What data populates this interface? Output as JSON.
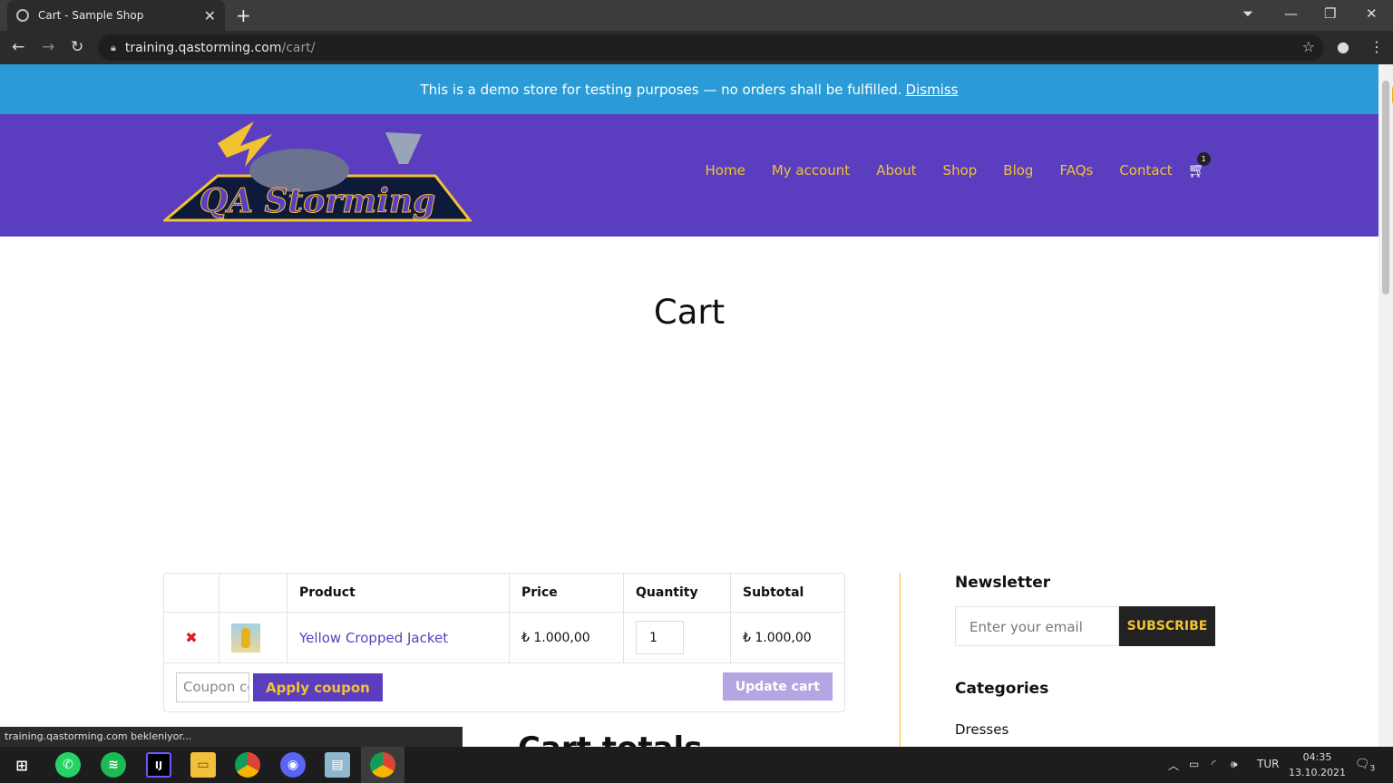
{
  "browser": {
    "tab_title": "Cart - Sample Shop",
    "url_host": "training.qastorming.com",
    "url_path": "/cart/"
  },
  "store": {
    "notice_text": "This is a demo store for testing purposes — no orders shall be fulfilled.",
    "notice_dismiss": "Dismiss",
    "logo_text": "QA Storming",
    "nav": [
      "Home",
      "My account",
      "About",
      "Shop",
      "Blog",
      "FAQs",
      "Contact"
    ],
    "cart_count": "1",
    "page_title": "Cart"
  },
  "cart": {
    "headers": [
      "Product",
      "Price",
      "Quantity",
      "Subtotal"
    ],
    "item": {
      "name": "Yellow Cropped Jacket",
      "price": "₺ 1.000,00",
      "quantity": "1",
      "subtotal": "₺ 1.000,00"
    },
    "coupon_placeholder": "Coupon code",
    "apply_label": "Apply coupon",
    "update_label": "Update cart",
    "totals_heading": "Cart totals"
  },
  "sidebar": {
    "newsletter_heading": "Newsletter",
    "email_placeholder": "Enter your email",
    "subscribe_label": "SUBSCRIBE",
    "categories_heading": "Categories",
    "category_first": "Dresses"
  },
  "status_text": "training.qastorming.com bekleniyor...",
  "taskbar": {
    "language": "TUR",
    "time": "04:35",
    "date": "13.10.2021",
    "notifications": "3"
  },
  "colors": {
    "notice_bg": "#2a9bd6",
    "header_bg": "#5a3ebf",
    "accent": "#f1c232"
  }
}
